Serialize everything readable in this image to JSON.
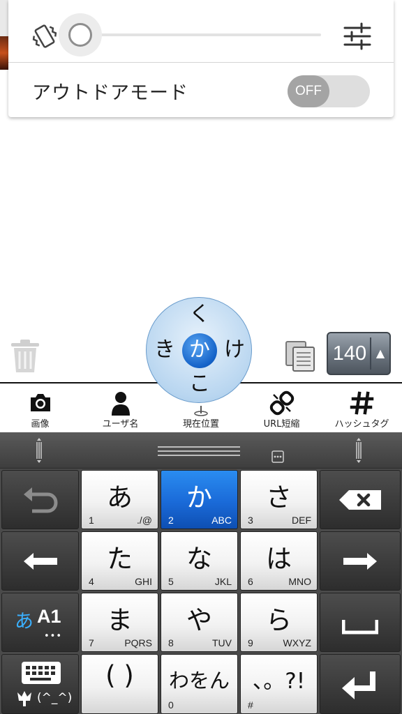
{
  "volume_panel": {
    "outdoor_mode_label": "アウトドアモード",
    "toggle_state": "OFF",
    "slider_level": 0,
    "icons": [
      "vibrate-icon",
      "equalizer-icon"
    ]
  },
  "compose": {
    "char_count": "140",
    "count_arrow": "▲",
    "icons": [
      "trash-icon",
      "copy-icon"
    ]
  },
  "shortcuts": [
    {
      "label": "画像",
      "icon": "camera-icon"
    },
    {
      "label": "ユーザ名",
      "icon": "user-icon"
    },
    {
      "label": "現在位置",
      "icon": "location-pin-icon"
    },
    {
      "label": "URL短縮",
      "icon": "link-icon"
    },
    {
      "label": "ハッシュタグ",
      "icon": "hashtag-icon"
    }
  ],
  "flick": {
    "center": "か",
    "up": "く",
    "left": "き",
    "right": "け",
    "down": "こ"
  },
  "keyboard": {
    "rows": [
      [
        {
          "main": "あ",
          "num": "1",
          "sub": "./@"
        },
        {
          "main": "か",
          "num": "2",
          "sub": "ABC"
        },
        {
          "main": "さ",
          "num": "3",
          "sub": "DEF"
        }
      ],
      [
        {
          "main": "た",
          "num": "4",
          "sub": "GHI"
        },
        {
          "main": "な",
          "num": "5",
          "sub": "JKL"
        },
        {
          "main": "は",
          "num": "6",
          "sub": "MNO"
        }
      ],
      [
        {
          "main": "ま",
          "num": "7",
          "sub": "PQRS"
        },
        {
          "main": "や",
          "num": "8",
          "sub": "TUV"
        },
        {
          "main": "ら",
          "num": "9",
          "sub": "WXYZ"
        }
      ],
      [
        {
          "main": "( )",
          "num": "",
          "sub": ""
        },
        {
          "main": "わをん",
          "num": "0",
          "sub": ""
        },
        {
          "main": "、。?!",
          "num": "#",
          "sub": ""
        }
      ]
    ],
    "mode_key": {
      "kana": "あ",
      "alnum": "A1",
      "dots": "•••"
    },
    "emoticon_label": "(^_^)",
    "accent_color": "#1a6ad8"
  }
}
